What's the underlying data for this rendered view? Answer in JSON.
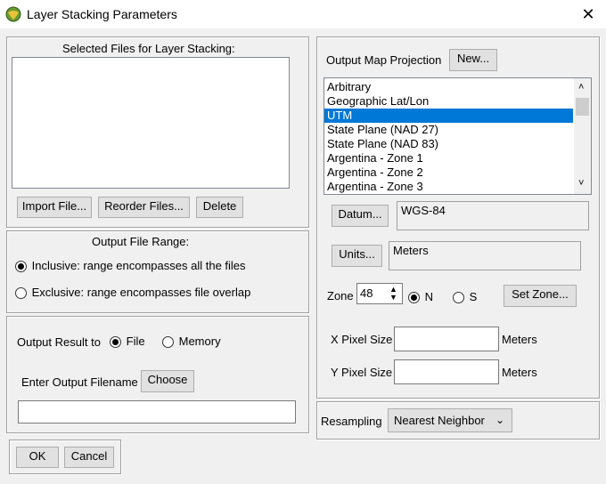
{
  "window": {
    "title": "Layer Stacking Parameters",
    "close_glyph": "✕",
    "icon": "app-globe-icon"
  },
  "files": {
    "heading": "Selected Files for Layer Stacking:",
    "import_label": "Import File...",
    "reorder_label": "Reorder Files...",
    "delete_label": "Delete"
  },
  "range": {
    "heading": "Output File Range:",
    "inclusive_label": "Inclusive: range encompasses all the files",
    "exclusive_label": "Exclusive: range encompasses file overlap",
    "selected": "inclusive"
  },
  "output": {
    "result_label": "Output Result to",
    "file_label": "File",
    "memory_label": "Memory",
    "selected": "file",
    "filename_label": "Enter Output Filename",
    "choose_label": "Choose",
    "filename_value": ""
  },
  "projection": {
    "label": "Output Map Projection",
    "new_label": "New...",
    "items": [
      "Arbitrary",
      "Geographic Lat/Lon",
      "UTM",
      "State Plane (NAD 27)",
      "State Plane (NAD 83)",
      "Argentina - Zone 1",
      "Argentina - Zone 2",
      "Argentina - Zone 3"
    ],
    "selected_index": 2,
    "selection_color": "#0078d7"
  },
  "datum": {
    "button_label": "Datum...",
    "value": "WGS-84"
  },
  "units": {
    "button_label": "Units...",
    "value": "Meters"
  },
  "zone": {
    "label": "Zone",
    "value": "48",
    "north_label": "N",
    "south_label": "S",
    "hemisphere": "N",
    "set_zone_label": "Set Zone..."
  },
  "pixel": {
    "x_label": "X Pixel Size",
    "x_value": "",
    "x_units": "Meters",
    "y_label": "Y Pixel Size",
    "y_value": "",
    "y_units": "Meters"
  },
  "resampling": {
    "label": "Resampling",
    "value": "Nearest Neighbor"
  },
  "footer": {
    "ok_label": "OK",
    "cancel_label": "Cancel"
  }
}
